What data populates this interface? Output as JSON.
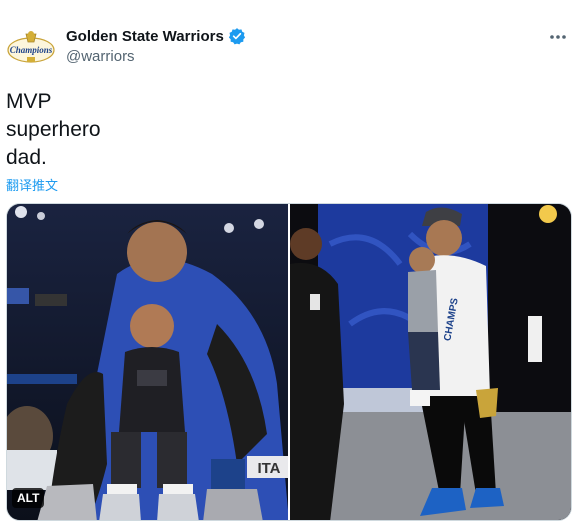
{
  "author": {
    "display_name": "Golden State Warriors",
    "handle": "@warriors",
    "avatar_text": "Champions",
    "verified": true
  },
  "tweet": {
    "text": "MVP\nsuperhero\ndad.",
    "translate_label": "翻译推文"
  },
  "media": {
    "alt_badge": "ALT",
    "photo_left_sign": "ITA",
    "photo_right_shirt_text": "CHAMPS"
  },
  "colors": {
    "link": "#1d9bf0",
    "verified": "#1d9bf0",
    "handle": "#536471"
  },
  "icons": {
    "verified": "verified-badge-icon",
    "more": "more-options-icon",
    "avatar": "champions-logo"
  }
}
